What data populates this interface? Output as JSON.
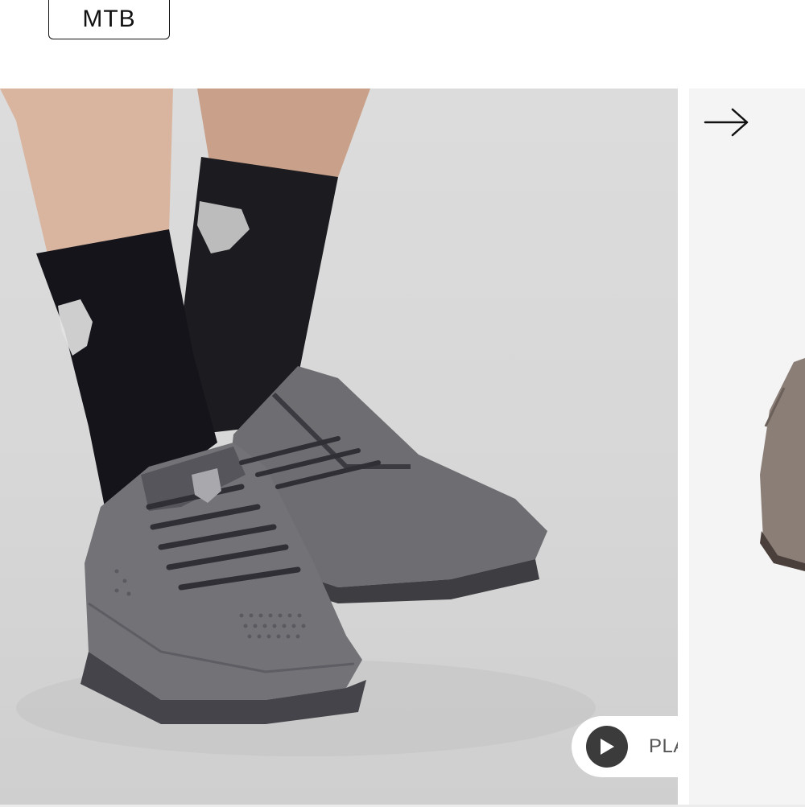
{
  "filters": {
    "active_label": "MTB"
  },
  "carousel": {
    "next_icon": "arrow-right-icon",
    "main_slide": {
      "image_desc_icon": "product-video-thumbnail"
    },
    "play_button": {
      "icon": "play-icon",
      "label": "PLAY"
    }
  },
  "colors": {
    "play_circle": "#3b3b3b",
    "background": "#ffffff",
    "shoe": "#6c6c70",
    "sock": "#17171b"
  }
}
